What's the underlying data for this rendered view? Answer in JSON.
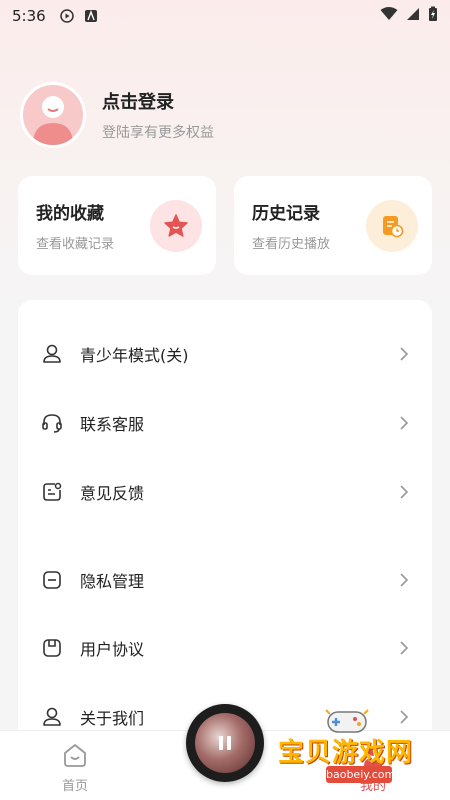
{
  "status_bar": {
    "time": "5:36"
  },
  "profile": {
    "title": "点击登录",
    "subtitle": "登陆享有更多权益"
  },
  "cards": {
    "favorites": {
      "title": "我的收藏",
      "subtitle": "查看收藏记录",
      "icon": "star-icon"
    },
    "history": {
      "title": "历史记录",
      "subtitle": "查看历史播放",
      "icon": "history-clock-icon"
    }
  },
  "menu": {
    "items": [
      {
        "label": "青少年模式(关)",
        "icon": "teen-mode-user-icon"
      },
      {
        "label": "联系客服",
        "icon": "headset-icon"
      },
      {
        "label": "意见反馈",
        "icon": "feedback-icon"
      },
      {
        "label": "隐私管理",
        "icon": "privacy-minus-icon"
      },
      {
        "label": "用户协议",
        "icon": "agreement-icon"
      },
      {
        "label": "关于我们",
        "icon": "about-user-icon"
      }
    ]
  },
  "bottom_nav": {
    "home_label": "首页",
    "mine_label": "我的"
  },
  "watermark": {
    "brand": "宝贝游戏网",
    "url": "baobeiy.com"
  },
  "colors": {
    "accent_red": "#e05252",
    "favorites_bg": "#fde3e3",
    "history_bg": "#fdeed9",
    "history_icon": "#f59a23"
  }
}
